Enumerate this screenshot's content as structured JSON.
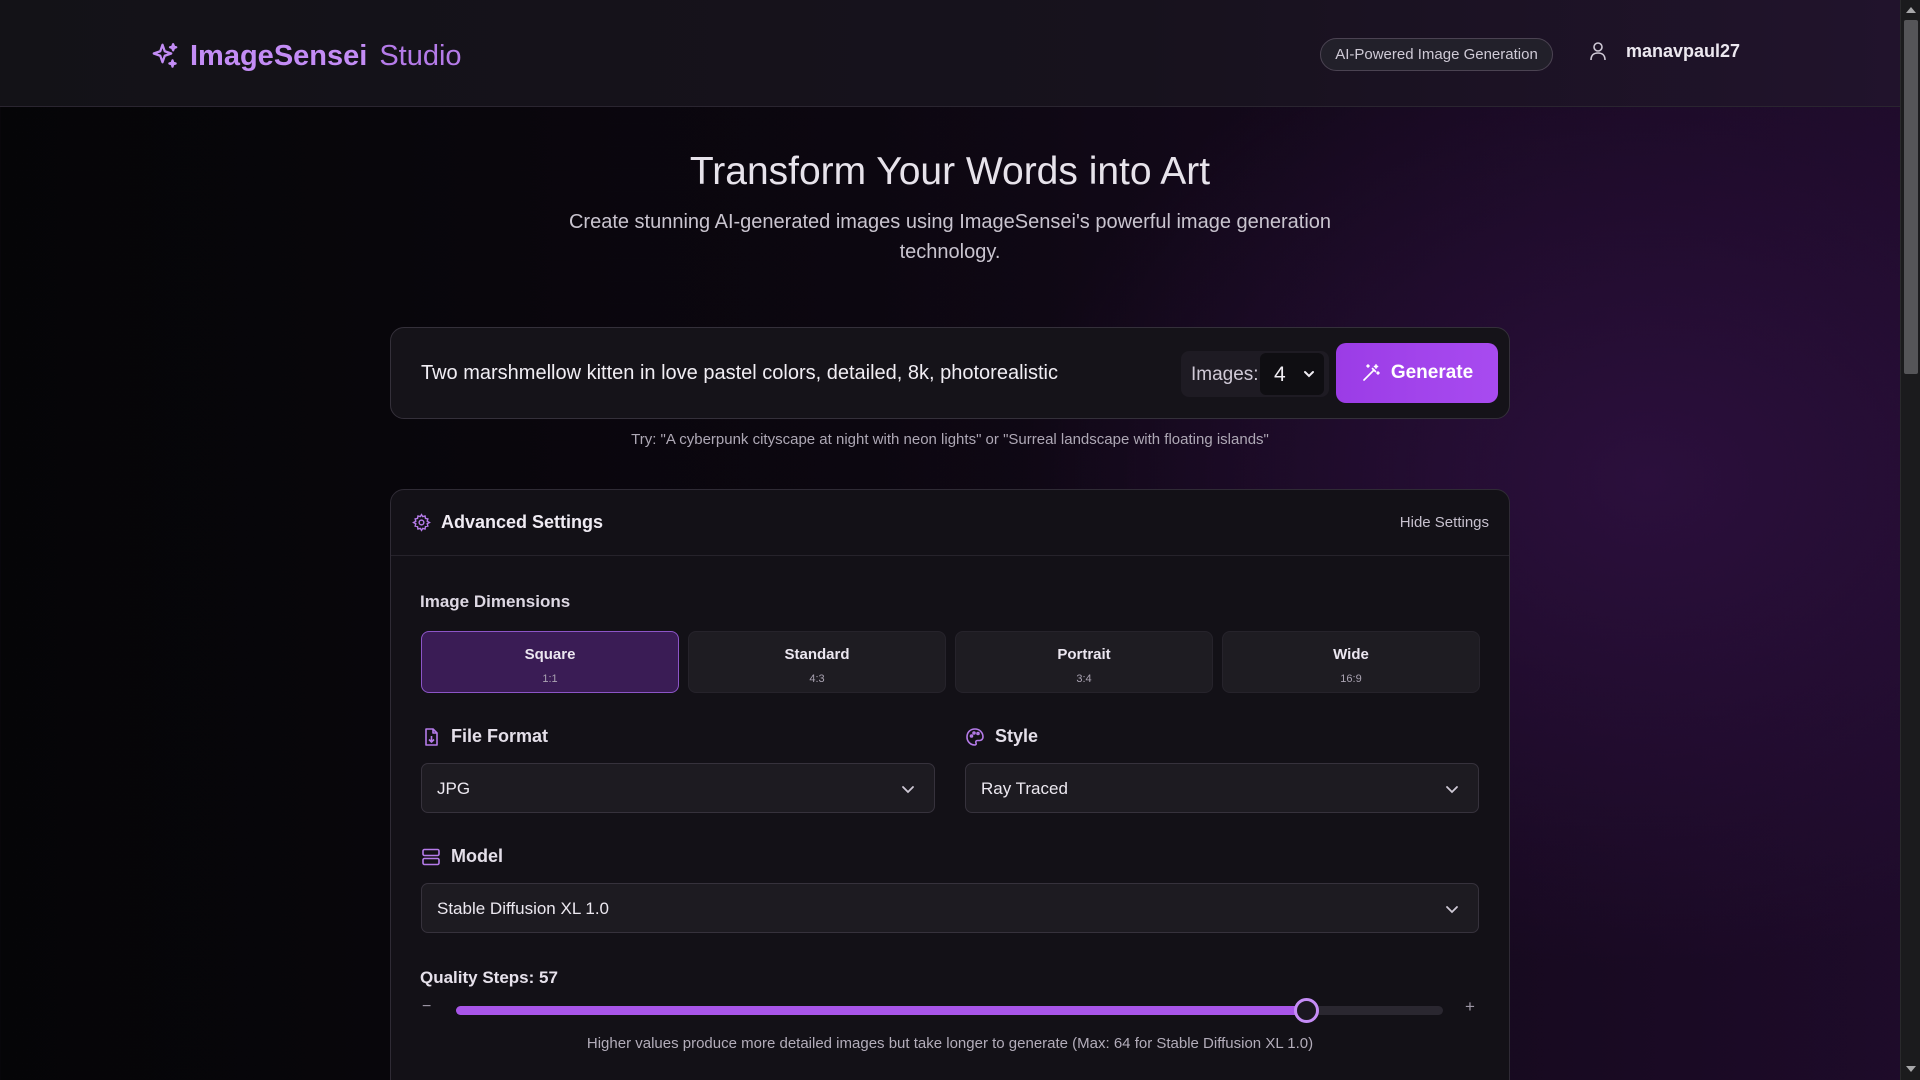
{
  "header": {
    "logo_main": "ImageSensei",
    "logo_sub": "Studio",
    "badge": "AI-Powered Image Generation",
    "username": "manavpaul27"
  },
  "hero": {
    "title": "Transform Your Words into Art",
    "subtitle": "Create stunning AI-generated images using ImageSensei's powerful image generation technology."
  },
  "prompt": {
    "value": "Two marshmellow kitten in love pastel colors, detailed, 8k, photorealistic",
    "images_label": "Images:",
    "images_count": "4",
    "generate_label": "Generate",
    "try_text": "Try: \"A cyberpunk cityscape at night with neon lights\" or \"Surreal landscape with floating islands\""
  },
  "settings": {
    "title": "Advanced Settings",
    "hide_label": "Hide Settings",
    "dimensions_label": "Image Dimensions",
    "dimensions": [
      {
        "name": "Square",
        "ratio": "1:1",
        "selected": true
      },
      {
        "name": "Standard",
        "ratio": "4:3",
        "selected": false
      },
      {
        "name": "Portrait",
        "ratio": "3:4",
        "selected": false
      },
      {
        "name": "Wide",
        "ratio": "16:9",
        "selected": false
      }
    ],
    "file_format_label": "File Format",
    "file_format_value": "JPG",
    "style_label": "Style",
    "style_value": "Ray Traced",
    "model_label": "Model",
    "model_value": "Stable Diffusion XL 1.0",
    "quality_label": "Quality Steps: 57",
    "quality_value": 57,
    "quality_max": 64,
    "quality_min_symbol": "−",
    "quality_plus_symbol": "+",
    "quality_help": "Higher values produce more detailed images but take longer to generate (Max: 64 for Stable Diffusion XL 1.0)"
  },
  "colors": {
    "accent": "#a855e8",
    "logo": "#c38cf5",
    "panel": "#131117"
  },
  "icons": {
    "logo": "sparkles-icon",
    "user": "user-icon",
    "generate": "magic-wand-icon",
    "settings": "gear-icon",
    "file_format": "file-icon",
    "style": "palette-icon",
    "model": "server-icon",
    "dropdown": "chevron-down-icon"
  }
}
